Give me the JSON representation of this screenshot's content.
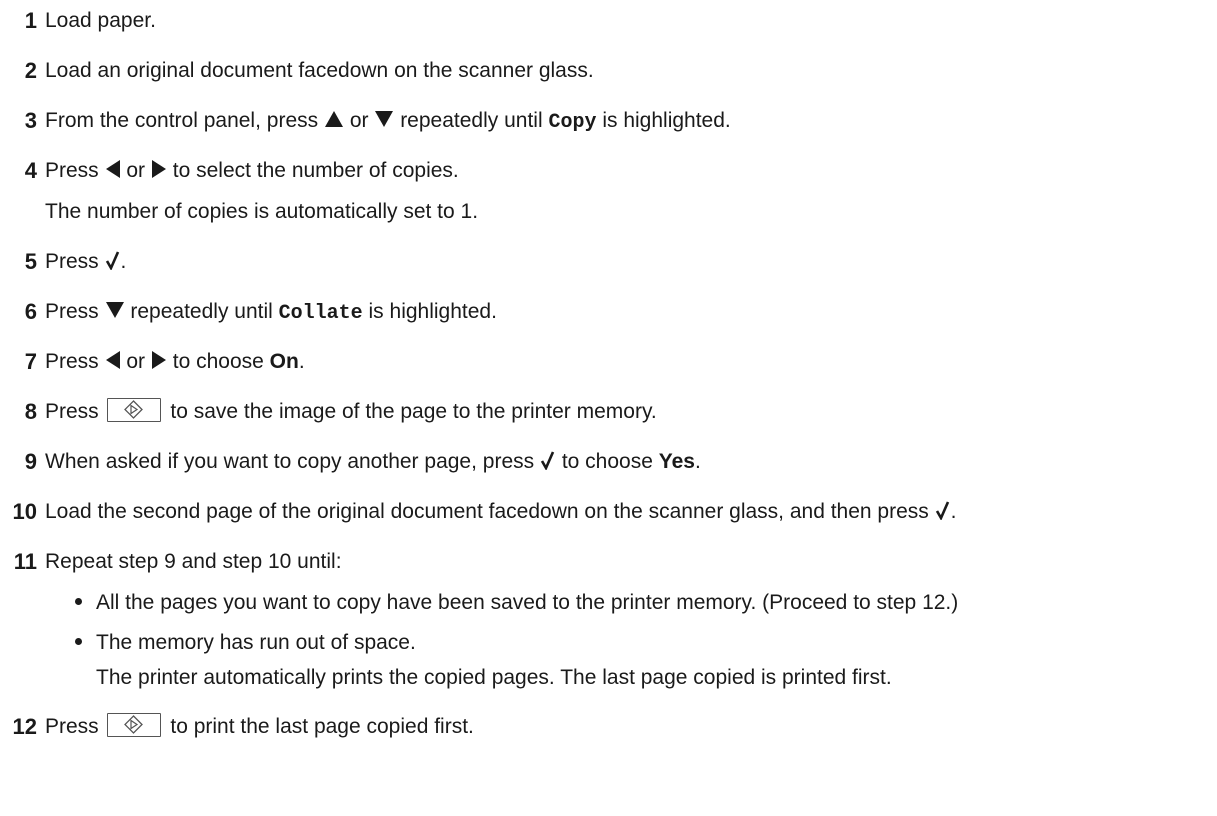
{
  "steps": [
    {
      "n": "1",
      "parts": [
        "Load paper."
      ]
    },
    {
      "n": "2",
      "parts": [
        "Load an original document facedown on the scanner glass."
      ]
    },
    {
      "n": "3",
      "parts": [
        "From the control panel, press",
        "or",
        "repeatedly until",
        "Copy",
        "is highlighted."
      ]
    },
    {
      "n": "4",
      "parts": [
        "Press",
        "or",
        "to select the number of copies."
      ],
      "note": "The number of copies is automatically set to 1."
    },
    {
      "n": "5",
      "parts": [
        "Press",
        "."
      ]
    },
    {
      "n": "6",
      "parts": [
        "Press",
        "repeatedly until",
        "Collate",
        "is highlighted."
      ]
    },
    {
      "n": "7",
      "parts": [
        "Press",
        "or",
        "to choose",
        "On",
        "."
      ]
    },
    {
      "n": "8",
      "parts": [
        "Press",
        "to save the image of the page to the printer memory."
      ]
    },
    {
      "n": "9",
      "parts": [
        "When asked if you want to copy another page, press",
        "to choose",
        "Yes",
        "."
      ]
    },
    {
      "n": "10",
      "parts": [
        "Load the second page of the original document facedown on the scanner glass, and then press",
        "."
      ]
    },
    {
      "n": "11",
      "parts": [
        "Repeat step 9 and step 10 until:"
      ],
      "bullets": [
        "All the pages you want to copy have been saved to the printer memory. (Proceed to step 12.)",
        "The memory has run out of space."
      ],
      "bullet_note": "The printer automatically prints the copied pages. The last page copied is printed first."
    },
    {
      "n": "12",
      "parts": [
        "Press",
        "to print the last page copied first."
      ]
    }
  ],
  "icons": {
    "up": "up-arrow-icon",
    "down": "down-arrow-icon",
    "left": "left-arrow-icon",
    "right": "right-arrow-icon",
    "check": "checkmark-icon",
    "start": "start-button-icon"
  }
}
